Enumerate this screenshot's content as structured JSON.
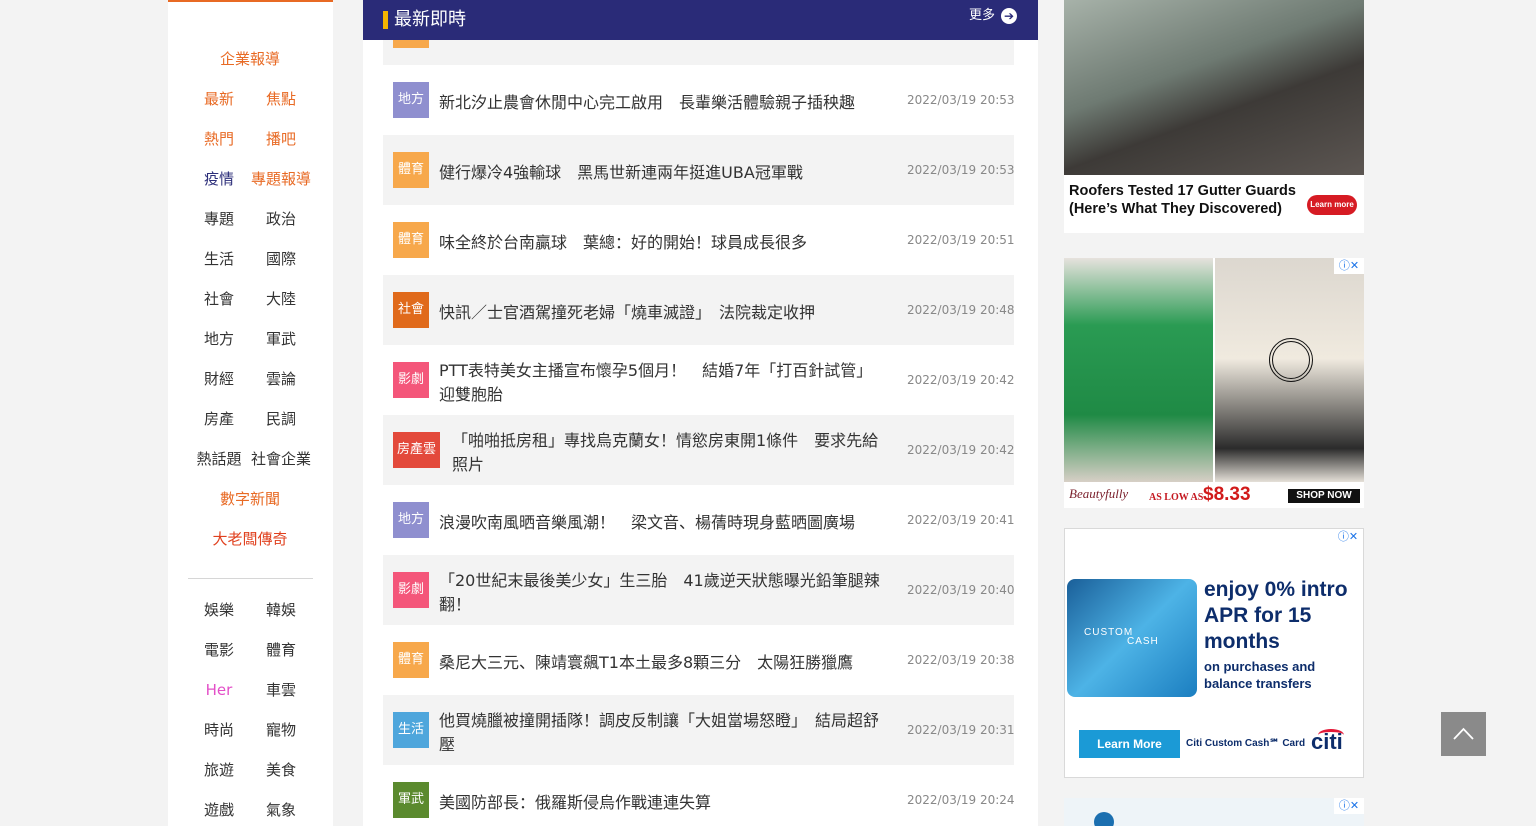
{
  "nav": {
    "rows": [
      {
        "c": {
          "label": "企業報導",
          "color": "orange"
        }
      },
      {
        "l": {
          "label": "最新",
          "color": "orange"
        },
        "r": {
          "label": "焦點",
          "color": "orange"
        }
      },
      {
        "l": {
          "label": "熱門",
          "color": "orange"
        },
        "r": {
          "label": "播吧",
          "color": "orange"
        }
      },
      {
        "l": {
          "label": "疫情",
          "color": "navy"
        },
        "r": {
          "label": "專題報導",
          "color": "orange"
        }
      },
      {
        "l": {
          "label": "專題",
          "color": "dark"
        },
        "r": {
          "label": "政治",
          "color": "dark"
        }
      },
      {
        "l": {
          "label": "生活",
          "color": "dark"
        },
        "r": {
          "label": "國際",
          "color": "dark"
        }
      },
      {
        "l": {
          "label": "社會",
          "color": "dark"
        },
        "r": {
          "label": "大陸",
          "color": "dark"
        }
      },
      {
        "l": {
          "label": "地方",
          "color": "dark"
        },
        "r": {
          "label": "軍武",
          "color": "dark"
        }
      },
      {
        "l": {
          "label": "財經",
          "color": "dark"
        },
        "r": {
          "label": "雲論",
          "color": "dark"
        }
      },
      {
        "l": {
          "label": "房產",
          "color": "dark"
        },
        "r": {
          "label": "民調",
          "color": "dark"
        }
      },
      {
        "l": {
          "label": "熱話題",
          "color": "dark"
        },
        "r": {
          "label": "社會企業",
          "color": "dark"
        }
      },
      {
        "c": {
          "label": "數字新聞",
          "color": "orange"
        }
      },
      {
        "c": {
          "label": "大老闆傳奇",
          "color": "redc"
        }
      },
      {
        "l": {
          "label": "娛樂",
          "color": "dark"
        },
        "r": {
          "label": "韓娛",
          "color": "dark"
        }
      },
      {
        "l": {
          "label": "電影",
          "color": "dark"
        },
        "r": {
          "label": "體育",
          "color": "dark"
        }
      },
      {
        "l": {
          "label": "Her",
          "color": "pink"
        },
        "r": {
          "label": "車雲",
          "color": "dark"
        }
      },
      {
        "l": {
          "label": "時尚",
          "color": "dark"
        },
        "r": {
          "label": "寵物",
          "color": "dark"
        }
      },
      {
        "l": {
          "label": "旅遊",
          "color": "dark"
        },
        "r": {
          "label": "美食",
          "color": "dark"
        }
      },
      {
        "l": {
          "label": "遊戲",
          "color": "dark"
        },
        "r": {
          "label": "氣象",
          "color": "dark"
        }
      }
    ]
  },
  "main": {
    "header": {
      "title": "最新即時",
      "more": "更多"
    },
    "news": [
      {
        "category": "",
        "badge_color": "#f7a84b",
        "title": "",
        "time": ""
      },
      {
        "category": "地方",
        "badge_color": "#8f8fcf",
        "title": "新北汐止農會休閒中心完工啟用　長輩樂活體驗親子插秧趣",
        "time": "2022/03/19 20:53"
      },
      {
        "category": "體育",
        "badge_color": "#f7a84b",
        "title": "健行爆冷4強輸球　黑馬世新連兩年挺進UBA冠軍戰",
        "time": "2022/03/19 20:53"
      },
      {
        "category": "體育",
        "badge_color": "#f7a84b",
        "title": "味全終於台南贏球　葉總：好的開始！球員成長很多",
        "time": "2022/03/19 20:51"
      },
      {
        "category": "社會",
        "badge_color": "#e06a1b",
        "title": "快訊／士官酒駕撞死老婦「燒車滅證」　法院裁定收押",
        "time": "2022/03/19 20:48"
      },
      {
        "category": "影劇",
        "badge_color": "#f4567a",
        "title": "PTT表特美女主播宣布懷孕5個月！　結婚7年「打百針試管」迎雙胞胎",
        "time": "2022/03/19 20:42"
      },
      {
        "category": "房產雲",
        "badge_color": "#e3493b",
        "title": "「啪啪抵房租」專找烏克蘭女！情慾房東開1條件　要求先給照片",
        "time": "2022/03/19 20:42"
      },
      {
        "category": "地方",
        "badge_color": "#8f8fcf",
        "title": "浪漫吹南風晒音樂風潮！　梁文音、楊蒨時現身藍晒圖廣場",
        "time": "2022/03/19 20:41"
      },
      {
        "category": "影劇",
        "badge_color": "#f4567a",
        "title": "「20世紀末最後美少女」生三胎　41歲逆天狀態曝光鉛筆腿辣翻！",
        "time": "2022/03/19 20:40"
      },
      {
        "category": "體育",
        "badge_color": "#f7a84b",
        "title": "桑尼大三元、陳靖寰飆T1本土最多8顆三分　太陽狂勝獵鷹",
        "time": "2022/03/19 20:38"
      },
      {
        "category": "生活",
        "badge_color": "#4ea6dc",
        "title": "他買燒臘被撞開插隊！調皮反制讓「大姐當場怒瞪」　結局超舒壓",
        "time": "2022/03/19 20:31"
      },
      {
        "category": "軍武",
        "badge_color": "#5b8a2e",
        "title": "美國防部長：俄羅斯侵烏作戰連連失算",
        "time": "2022/03/19 20:24"
      }
    ]
  },
  "ads": {
    "roof": {
      "text": "Roofers Tested 17 Gutter Guards (Here’s What They Discovered)",
      "button": "Learn more"
    },
    "blouse": {
      "brand": "Beautyfully",
      "as_low_as": "AS LOW AS",
      "price": "$8.33",
      "shop": "SHOP NOW",
      "adchoice": "ⓘ✕"
    },
    "citi": {
      "headline": "enjoy 0% intro APR for 15 months",
      "sub": "on purchases and balance transfers",
      "learn": "Learn More",
      "card_name": "Citi Custom Cash℠ Card",
      "logo": "citi",
      "card_line1": "CUSTOM",
      "card_line2": "CASH",
      "adchoice": "ⓘ✕"
    },
    "bottom": {
      "adchoice": "ⓘ✕"
    }
  }
}
